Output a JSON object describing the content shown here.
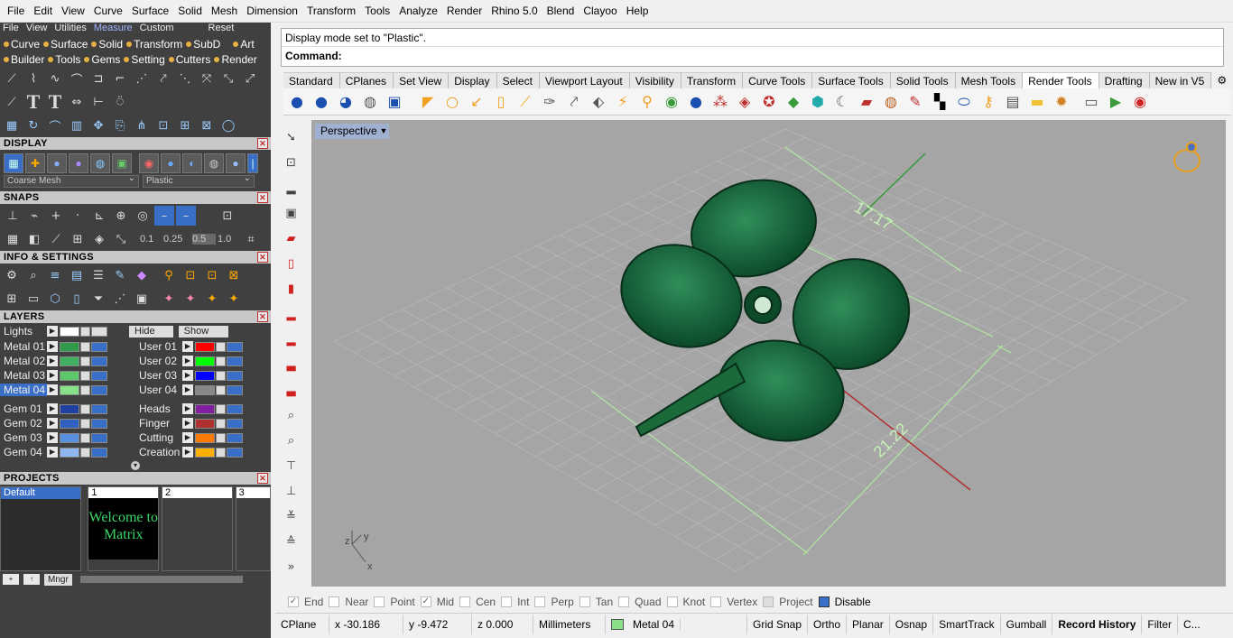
{
  "menubar": {
    "items": [
      "File",
      "Edit",
      "View",
      "Curve",
      "Surface",
      "Solid",
      "Mesh",
      "Dimension",
      "Transform",
      "Tools",
      "Analyze",
      "Render",
      "Rhino 5.0",
      "Blend",
      "Clayoo",
      "Help"
    ]
  },
  "left": {
    "row0": [
      "File",
      "View",
      "Utilities",
      "Measure",
      "Custom",
      "Reset"
    ],
    "row1": [
      "Curve",
      "Surface",
      "Solid",
      "Transform",
      "SubD",
      "Art"
    ],
    "row2": [
      "Builder",
      "Tools",
      "Gems",
      "Setting",
      "Cutters",
      "Render"
    ],
    "display": {
      "title": "DISPLAY",
      "mesh": "Coarse Mesh",
      "mode": "Plastic"
    },
    "snaps": {
      "title": "SNAPS",
      "vals": [
        "0.1",
        "0.25",
        "0.5",
        "1.0"
      ]
    },
    "info": {
      "title": "INFO & SETTINGS"
    },
    "layers": {
      "title": "LAYERS",
      "lights": "Lights",
      "hide": "Hide",
      "show": "Show",
      "left": [
        {
          "name": "Metal 01",
          "c": "#2f9a4a"
        },
        {
          "name": "Metal 02",
          "c": "#40b060"
        },
        {
          "name": "Metal 03",
          "c": "#5cc86a"
        },
        {
          "name": "Metal 04",
          "c": "#88e088"
        },
        {
          "name": "Gem 01",
          "c": "#2040a0"
        },
        {
          "name": "Gem 02",
          "c": "#3060c0"
        },
        {
          "name": "Gem 03",
          "c": "#5a90e0"
        },
        {
          "name": "Gem 04",
          "c": "#90b8f0"
        }
      ],
      "right": [
        {
          "name": "User 01",
          "c": "#ff0000"
        },
        {
          "name": "User 02",
          "c": "#00ff00"
        },
        {
          "name": "User 03",
          "c": "#0000ff"
        },
        {
          "name": "User 04",
          "c": "#888888"
        },
        {
          "name": "Heads",
          "c": "#8020a0"
        },
        {
          "name": "Finger",
          "c": "#b03030"
        },
        {
          "name": "Cutting",
          "c": "#ff7a00"
        },
        {
          "name": "Creation",
          "c": "#ffb000"
        }
      ]
    },
    "projects": {
      "title": "PROJECTS",
      "default": "Default",
      "slots": [
        "1",
        "2",
        "3"
      ],
      "welcome1": "Welcome to",
      "welcome2": "Matrix",
      "mngr": "Mngr"
    }
  },
  "command": {
    "history": "Display mode set to \"Plastic\".",
    "prompt": "Command:"
  },
  "tabs": [
    "Standard",
    "CPlanes",
    "Set View",
    "Display",
    "Select",
    "Viewport Layout",
    "Visibility",
    "Transform",
    "Curve Tools",
    "Surface Tools",
    "Solid Tools",
    "Mesh Tools",
    "Render Tools",
    "Drafting",
    "New in V5"
  ],
  "viewport": {
    "label": "Perspective",
    "dim1": "17.17",
    "dim2": "21.22",
    "axis_x": "x",
    "axis_y": "y",
    "axis_z": "z"
  },
  "osnap": [
    "End",
    "Near",
    "Point",
    "Mid",
    "Cen",
    "Int",
    "Perp",
    "Tan",
    "Quad",
    "Knot",
    "Vertex",
    "Project",
    "Disable"
  ],
  "status": {
    "cplane": "CPlane",
    "x": "x -30.186",
    "y": "y -9.472",
    "z": "z 0.000",
    "units": "Millimeters",
    "layer": "Metal 04",
    "buttons": [
      "Grid Snap",
      "Ortho",
      "Planar",
      "Osnap",
      "SmartTrack",
      "Gumball",
      "Record History",
      "Filter",
      "C..."
    ]
  }
}
